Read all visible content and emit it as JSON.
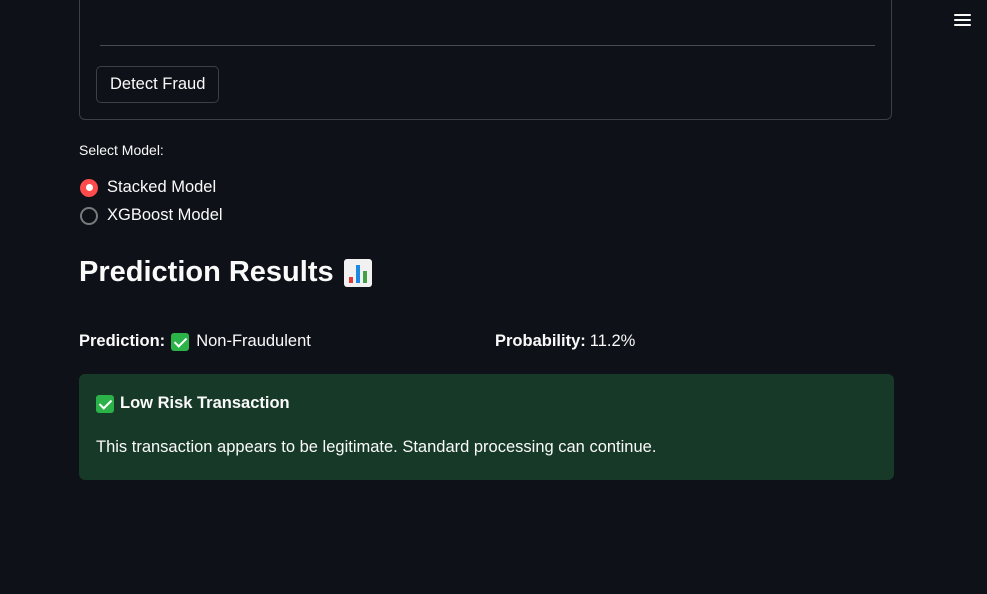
{
  "form": {
    "detect_button_label": "Detect Fraud"
  },
  "model_select": {
    "label": "Select Model:",
    "options": [
      {
        "label": "Stacked Model",
        "selected": true
      },
      {
        "label": "XGBoost Model",
        "selected": false
      }
    ]
  },
  "results": {
    "heading": "Prediction Results",
    "heading_icon": "bar-chart-icon",
    "prediction_label": "Prediction:",
    "prediction_icon": "check-mark-icon",
    "prediction_value": "Non-Fraudulent",
    "probability_label": "Probability:",
    "probability_value": "11.2%"
  },
  "alert": {
    "icon": "check-mark-icon",
    "title": "Low Risk Transaction",
    "message": "This transaction appears to be legitimate. Standard processing can continue.",
    "background_color": "#173928"
  },
  "colors": {
    "background": "#0e1117",
    "accent": "#ff4b4b",
    "success": "#2bb34a"
  }
}
